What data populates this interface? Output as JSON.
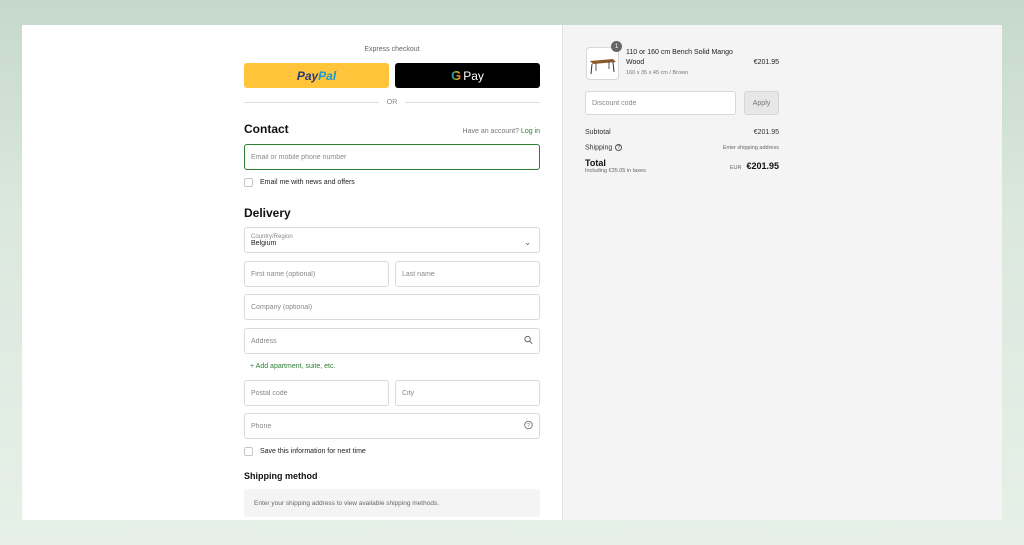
{
  "express": {
    "title": "Express checkout",
    "paypal_part1": "Pay",
    "paypal_part2": "Pal",
    "gpay_g": "G",
    "gpay_label": "Pay",
    "or_label": "OR"
  },
  "contact": {
    "heading": "Contact",
    "account_prompt": "Have an account?",
    "login_label": "Log in",
    "email_placeholder": "Email or mobile phone number",
    "newsletter_label": "Email me with news and offers"
  },
  "delivery": {
    "heading": "Delivery",
    "country_label": "Country/Region",
    "country_value": "Belgium",
    "first_name_placeholder": "First name (optional)",
    "last_name_placeholder": "Last name",
    "company_placeholder": "Company (optional)",
    "address_placeholder": "Address",
    "add_apartment_label": "+ Add apartment, suite, etc.",
    "postal_placeholder": "Postal code",
    "city_placeholder": "City",
    "phone_placeholder": "Phone",
    "save_info_label": "Save this information for next time"
  },
  "shipping": {
    "heading": "Shipping method",
    "message": "Enter your shipping address to view available shipping methods."
  },
  "summary": {
    "item": {
      "quantity": "1",
      "name": "110 or 160 cm Bench Solid Mango Wood",
      "variant": "160 x 35 x 45 cm / Brown",
      "price": "€201.95"
    },
    "discount_placeholder": "Discount code",
    "apply_label": "Apply",
    "subtotal_label": "Subtotal",
    "subtotal_value": "€201.95",
    "shipping_label": "Shipping",
    "shipping_value": "Enter shipping address",
    "total_label": "Total",
    "taxes_note": "Including €35.05 in taxes",
    "currency": "EUR",
    "total_value": "€201.95"
  },
  "colors": {
    "accent": "#2e7d32",
    "paypal": "#ffc439",
    "gpay": "#000000"
  }
}
